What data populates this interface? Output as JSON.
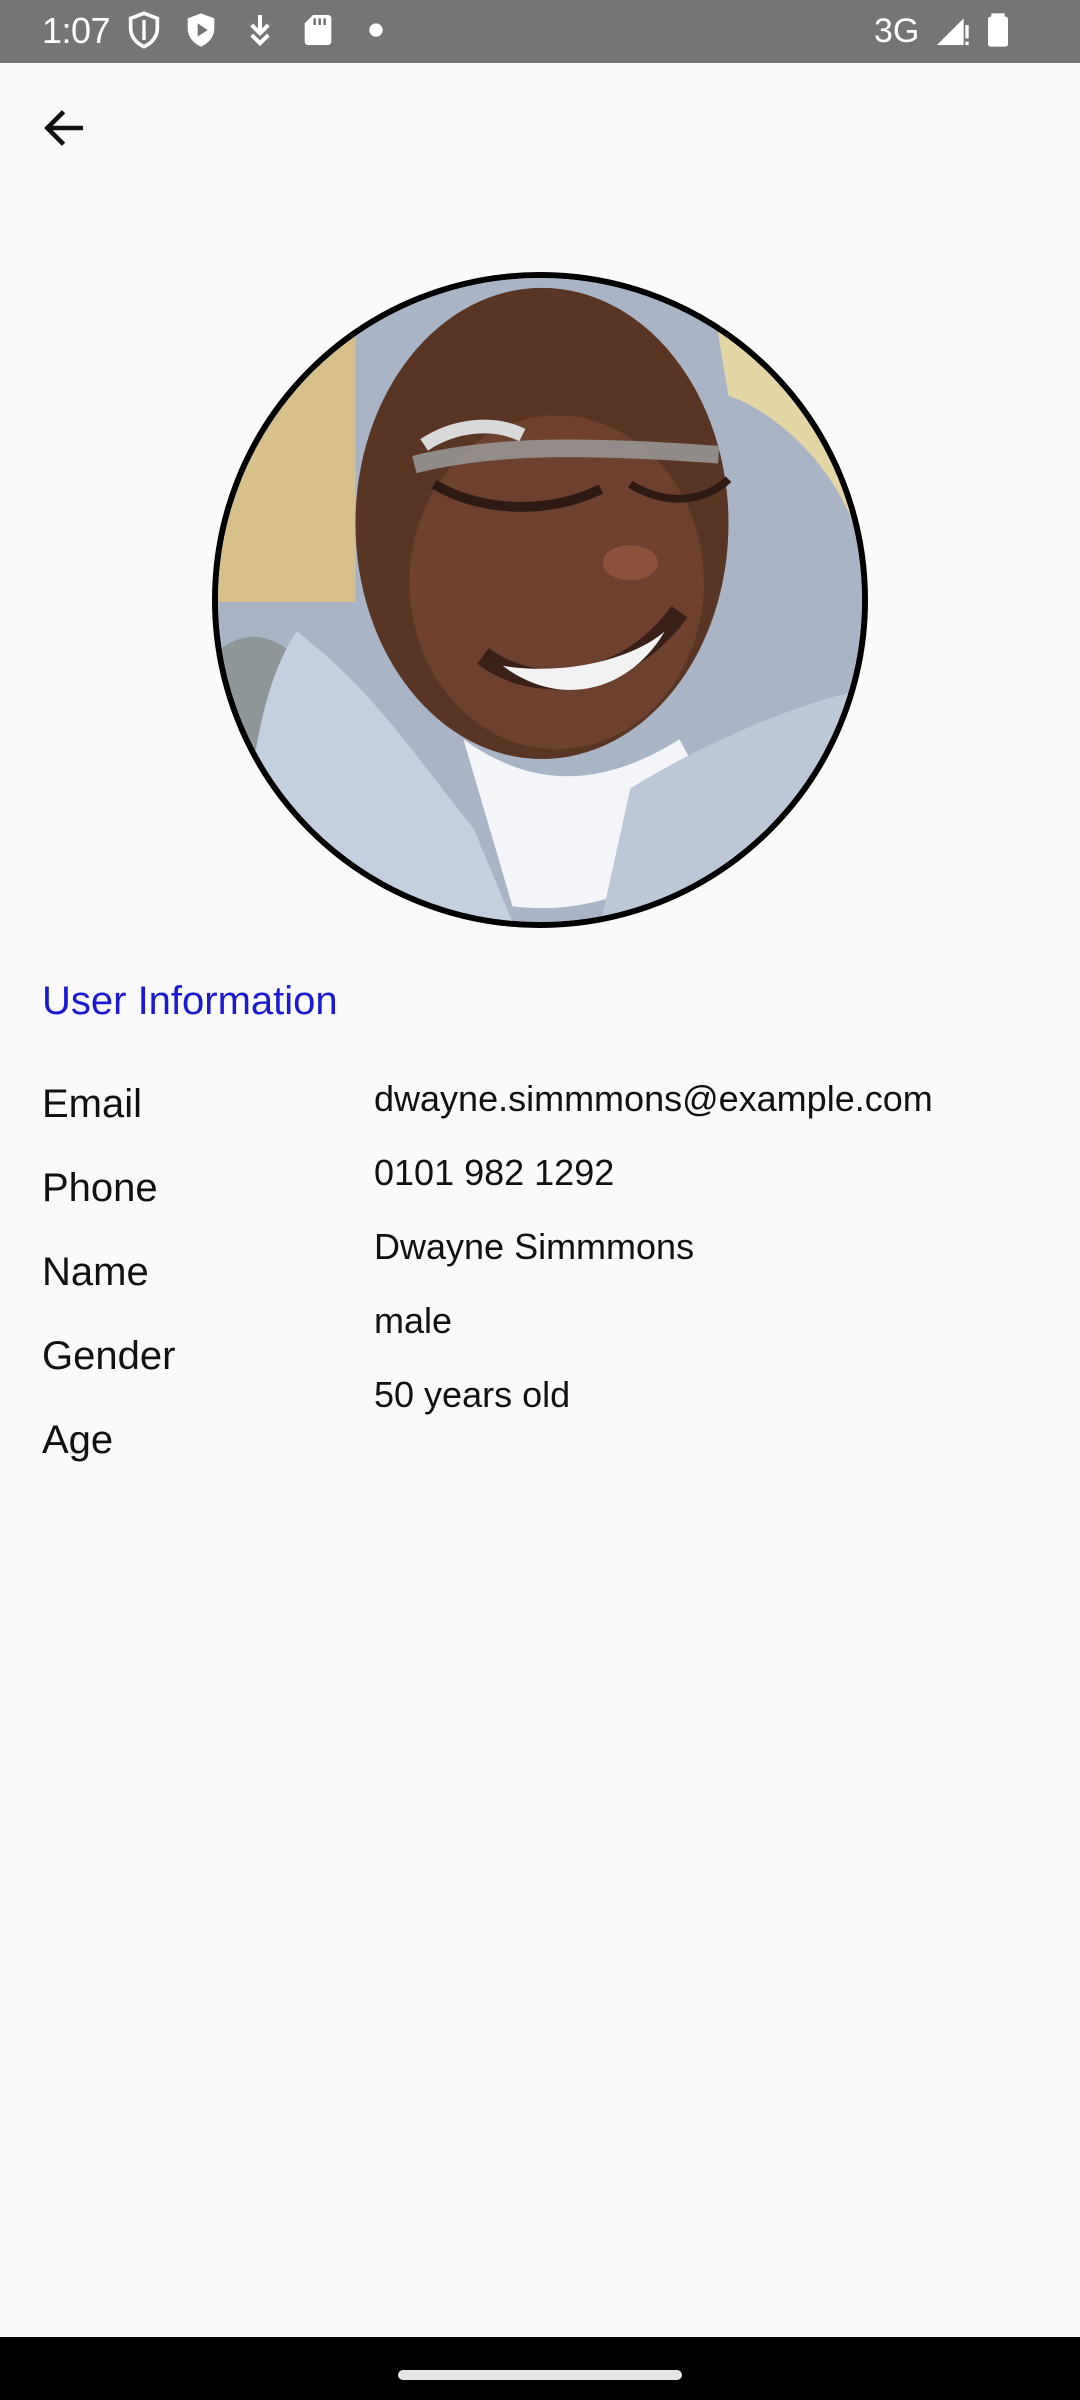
{
  "status_bar": {
    "time": "1:07",
    "network": "3G",
    "icons": [
      "shield-icon",
      "play-shield-icon",
      "download-icon",
      "sd-card-icon",
      "dot-icon",
      "signal-icon",
      "battery-icon"
    ]
  },
  "app_bar": {
    "back_icon": "arrow-left-icon"
  },
  "profile": {
    "section_title": "User Information",
    "labels": {
      "email": "Email",
      "phone": "Phone",
      "name": "Name",
      "gender": "Gender",
      "age": "Age"
    },
    "values": {
      "email": "dwayne.simmmons@example.com",
      "phone": "0101 982 1292",
      "name": "Dwayne Simmmons",
      "gender": "male",
      "age": "50 years old"
    }
  },
  "colors": {
    "status_bar": "#757575",
    "background": "#fafafa",
    "section_title": "#1a1ad6",
    "text": "#111111",
    "nav_bar": "#000000"
  }
}
